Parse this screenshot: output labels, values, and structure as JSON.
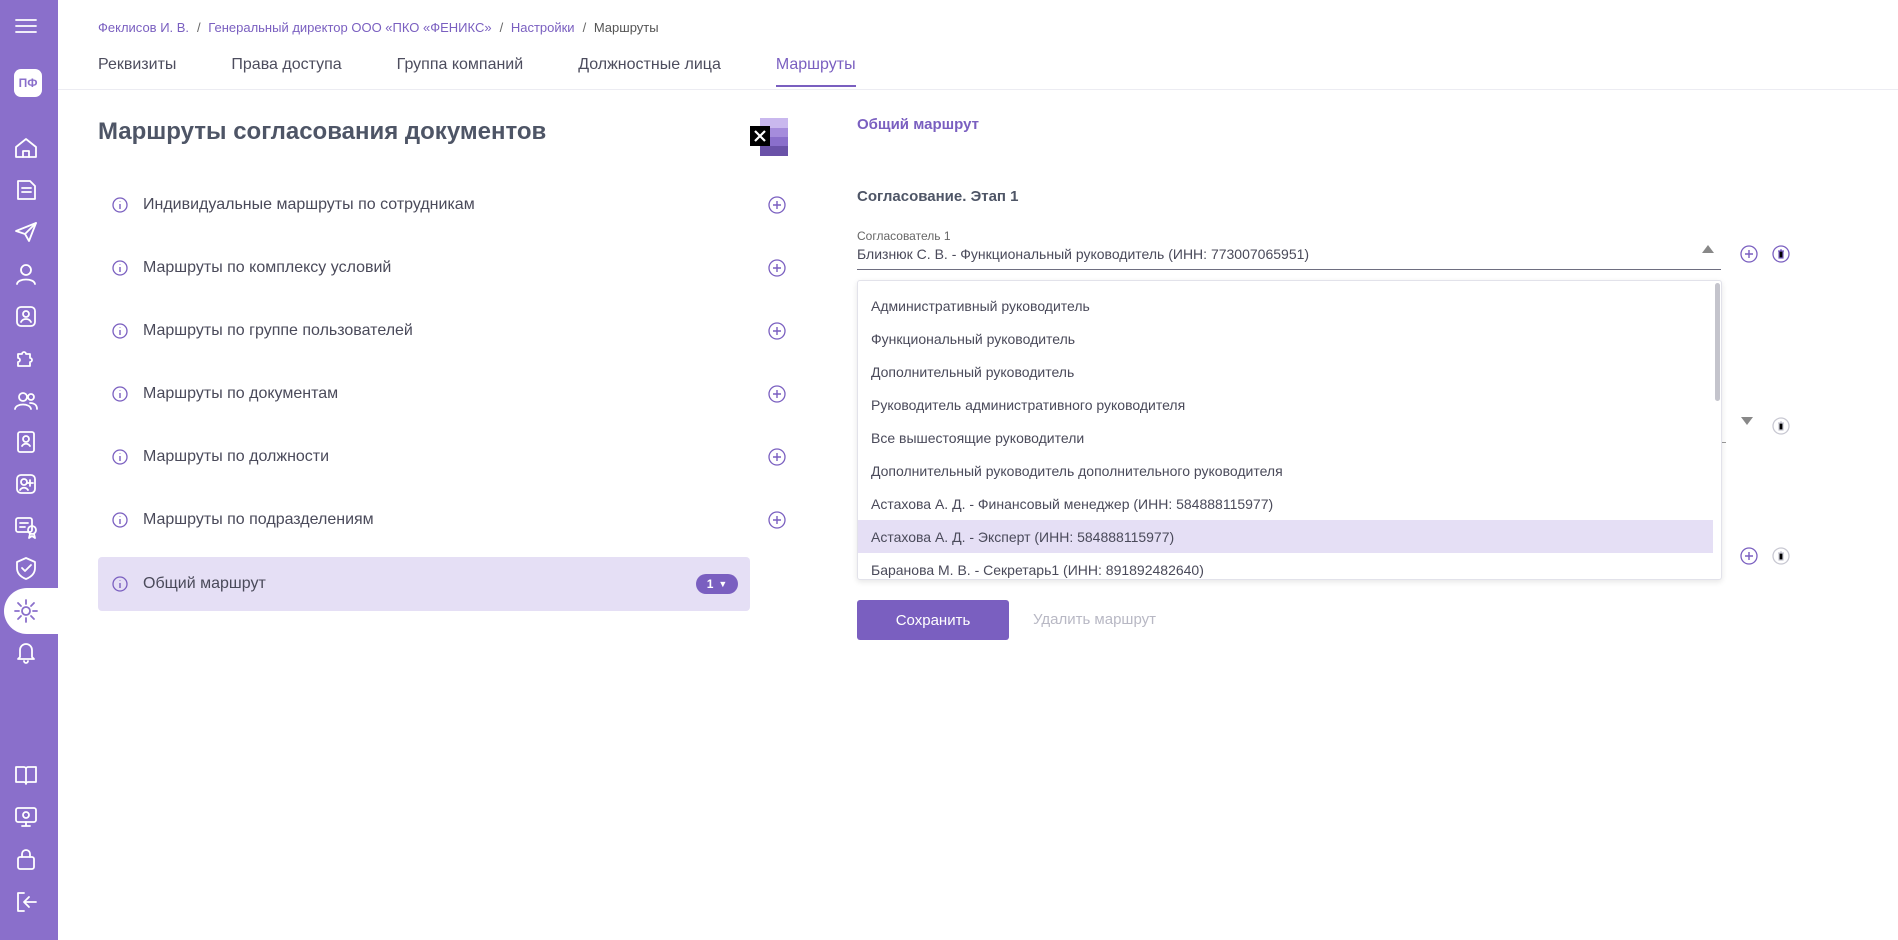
{
  "sidebar": {
    "avatar": "ПФ"
  },
  "breadcrumb": {
    "items": [
      "Феклисов И. В.",
      "Генеральный директор ООО «ПКО «ФЕНИКС»",
      "Настройки"
    ],
    "current": "Маршруты"
  },
  "tabs": [
    {
      "label": "Реквизиты"
    },
    {
      "label": "Права доступа"
    },
    {
      "label": "Группа компаний"
    },
    {
      "label": "Должностные лица"
    },
    {
      "label": "Маршруты"
    }
  ],
  "left": {
    "title": "Маршруты согласования документов",
    "items": [
      {
        "label": "Индивидуальные маршруты по сотрудникам"
      },
      {
        "label": "Маршруты по комплексу условий"
      },
      {
        "label": "Маршруты по группе пользователей"
      },
      {
        "label": "Маршруты по документам"
      },
      {
        "label": "Маршруты по должности"
      },
      {
        "label": "Маршруты по подразделениям"
      },
      {
        "label": "Общий маршрут",
        "badge": "1"
      }
    ]
  },
  "right": {
    "title": "Общий маршрут",
    "stage": "Согласование. Этап 1",
    "approver_label": "Согласователь 1",
    "approver_value": "Близнюк С. В. - Функциональный руководитель (ИНН: 773007065951)",
    "dropdown": [
      "Административный руководитель",
      "Функциональный руководитель",
      "Дополнительный руководитель",
      "Руководитель административного руководителя",
      "Все вышестоящие руководители",
      "Дополнительный руководитель дополнительного руководителя",
      "Астахова А. Д. - Финансовый менеджер (ИНН: 584888115977)",
      "Астахова А. Д. - Эксперт (ИНН: 584888115977)",
      "Баранова М. В. - Секретарь1 (ИНН: 891892482640)"
    ],
    "save_label": "Сохранить",
    "delete_label": "Удалить маршрут"
  },
  "colors": {
    "accent": "#7a5fc0",
    "sidebar": "#8a6fcb",
    "selected_bg": "#e5dff5"
  }
}
